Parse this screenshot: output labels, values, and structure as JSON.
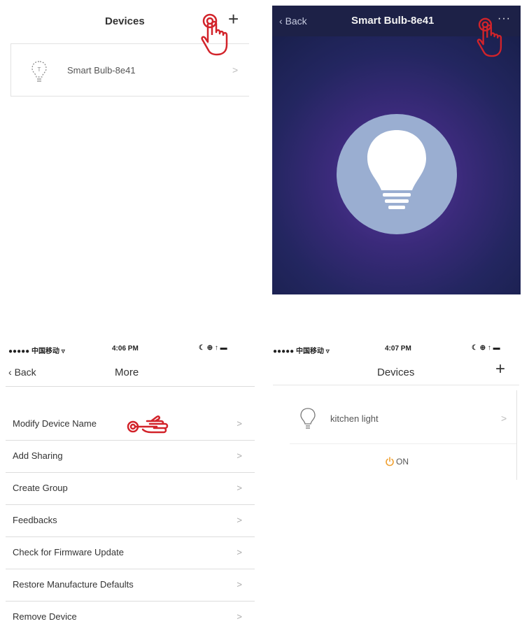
{
  "panel1": {
    "title": "Devices",
    "add_icon": "plus-icon",
    "device_name": "Smart Bulb-8e41",
    "chevron": ">"
  },
  "panel2": {
    "back_label": "Back",
    "title": "Smart Bulb-8e41",
    "more_icon": "more-icon",
    "more_glyph": "···",
    "colors": {
      "bg_dark": "#1d2147",
      "glow": "#5a3aa0",
      "circle": "#9aaed1"
    }
  },
  "panel3": {
    "status_carrier": "●●●●● 中国移动 ▿",
    "status_time": "4:06 PM",
    "status_right": "☾ ⊕ ↑ ▬",
    "back_label": "Back",
    "title": "More",
    "items": [
      {
        "label": "Modify Device Name",
        "chevron": ">"
      },
      {
        "label": "Add Sharing",
        "chevron": ">"
      },
      {
        "label": "Create Group",
        "chevron": ">"
      },
      {
        "label": "Feedbacks",
        "chevron": ">"
      },
      {
        "label": "Check for Firmware Update",
        "chevron": ">"
      },
      {
        "label": "Restore Manufacture Defaults",
        "chevron": ">"
      },
      {
        "label": "Remove Device",
        "chevron": ">"
      }
    ]
  },
  "panel4": {
    "status_carrier": "●●●●● 中国移动 ▿",
    "status_time": "4:07 PM",
    "status_right": "☾ ⊕ ↑ ▬",
    "title": "Devices",
    "device_name": "kitchen light",
    "chevron": ">",
    "power_state": "ON",
    "colors": {
      "power": "#f0a030"
    }
  }
}
